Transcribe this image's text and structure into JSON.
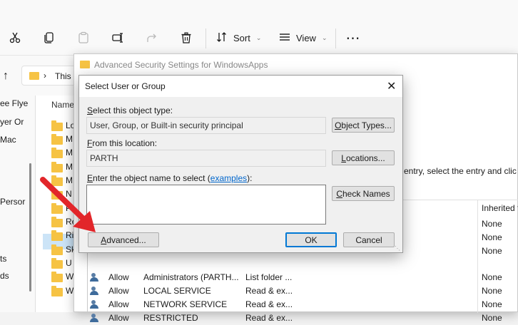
{
  "toolbar": {
    "sort_label": "Sort",
    "view_label": "View",
    "icons": [
      "cut-icon",
      "copy-icon",
      "paste-icon",
      "rename-icon",
      "share-icon",
      "delete-icon",
      "sort-icon",
      "view-icon",
      "more-icon"
    ]
  },
  "address": {
    "path_partial": "This"
  },
  "nav_pane": {
    "items": [
      "ee Flye",
      "yer Or",
      "Mac",
      "Persor",
      "ts",
      "ds"
    ]
  },
  "file_pane": {
    "header": "Name",
    "items": [
      "Lo",
      "M",
      "M",
      "M",
      "M",
      "N",
      "P",
      "Re",
      "Ri",
      "Sk",
      "U",
      "W",
      "W"
    ]
  },
  "advanced_window": {
    "title": "Advanced Security Settings for WindowsApps",
    "instruction_partial": "entry, select the entry and clic",
    "inherited_header": "Inherited f",
    "none": "None",
    "rows": [
      {
        "type": "Allow",
        "principal": "Administrators (PARTH...",
        "access": "List folder ...",
        "inherited": "None"
      },
      {
        "type": "Allow",
        "principal": "LOCAL SERVICE",
        "access": "Read & ex...",
        "inherited": "None"
      },
      {
        "type": "Allow",
        "principal": "NETWORK SERVICE",
        "access": "Read & ex...",
        "inherited": "None"
      },
      {
        "type": "Allow",
        "principal": "RESTRICTED",
        "access": "Read & ex...",
        "inherited": "None"
      }
    ]
  },
  "dialog": {
    "title": "Select User or Group",
    "object_type_label": "Select this object type:",
    "object_type_value": "User, Group, or Built-in security principal",
    "object_types_button": "Object Types...",
    "location_label": "From this location:",
    "location_value": "PARTH",
    "locations_button": "Locations...",
    "enter_name_label": "Enter the object name to select (",
    "examples_link": "examples",
    "enter_name_label_end": "):",
    "object_name_value": "",
    "check_names_button": "Check Names",
    "advanced_button": "Advanced...",
    "ok_button": "OK",
    "cancel_button": "Cancel"
  },
  "colors": {
    "arrow": "#e2262a",
    "folder": "#f6c344",
    "accent": "#0078d4"
  }
}
